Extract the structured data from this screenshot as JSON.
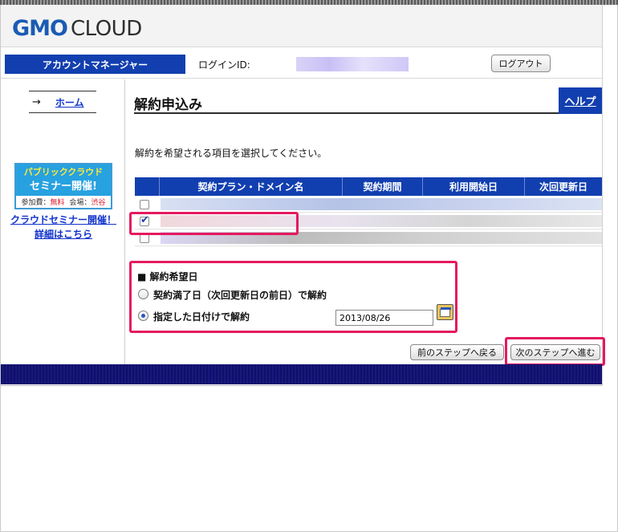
{
  "header": {
    "logo_main": "GMO",
    "logo_sub": "CLOUD"
  },
  "userbar": {
    "account_tab": "アカウントマネージャー",
    "login_label": "ログインID:",
    "logout_label": "ログアウト"
  },
  "sidebar": {
    "home_arrow": "→",
    "home_label": "ホーム",
    "banner": {
      "line1": "パブリッククラウド",
      "line2": "セミナー開催!",
      "fee_label": "参加費：",
      "fee_value": "無料",
      "venue_label": "会場：",
      "venue_value": "渋谷"
    },
    "seminar_link": "クラウドセミナー開催！詳細はこちら"
  },
  "main": {
    "title": "解約申込み",
    "help_label": "ヘルプ",
    "instruction": "解約を希望される項目を選択してください。",
    "table": {
      "columns": [
        "契約プラン・ドメイン名",
        "契約期間",
        "利用開始日",
        "次回更新日"
      ],
      "rows": [
        {
          "checked": false
        },
        {
          "checked": true
        },
        {
          "checked": false
        }
      ]
    },
    "date_section": {
      "label": "■ 解約希望日",
      "option1": "契約満了日（次回更新日の前日）で解約",
      "option2": "指定した日付けで解約",
      "selected": 2,
      "date_value": "2013/08/26"
    },
    "buttons": {
      "back": "前のステップへ戻る",
      "next": "次のステップへ進む"
    }
  },
  "colors": {
    "brand_blue": "#123fb0",
    "highlight": "#e5195f",
    "footer": "#15157a"
  }
}
